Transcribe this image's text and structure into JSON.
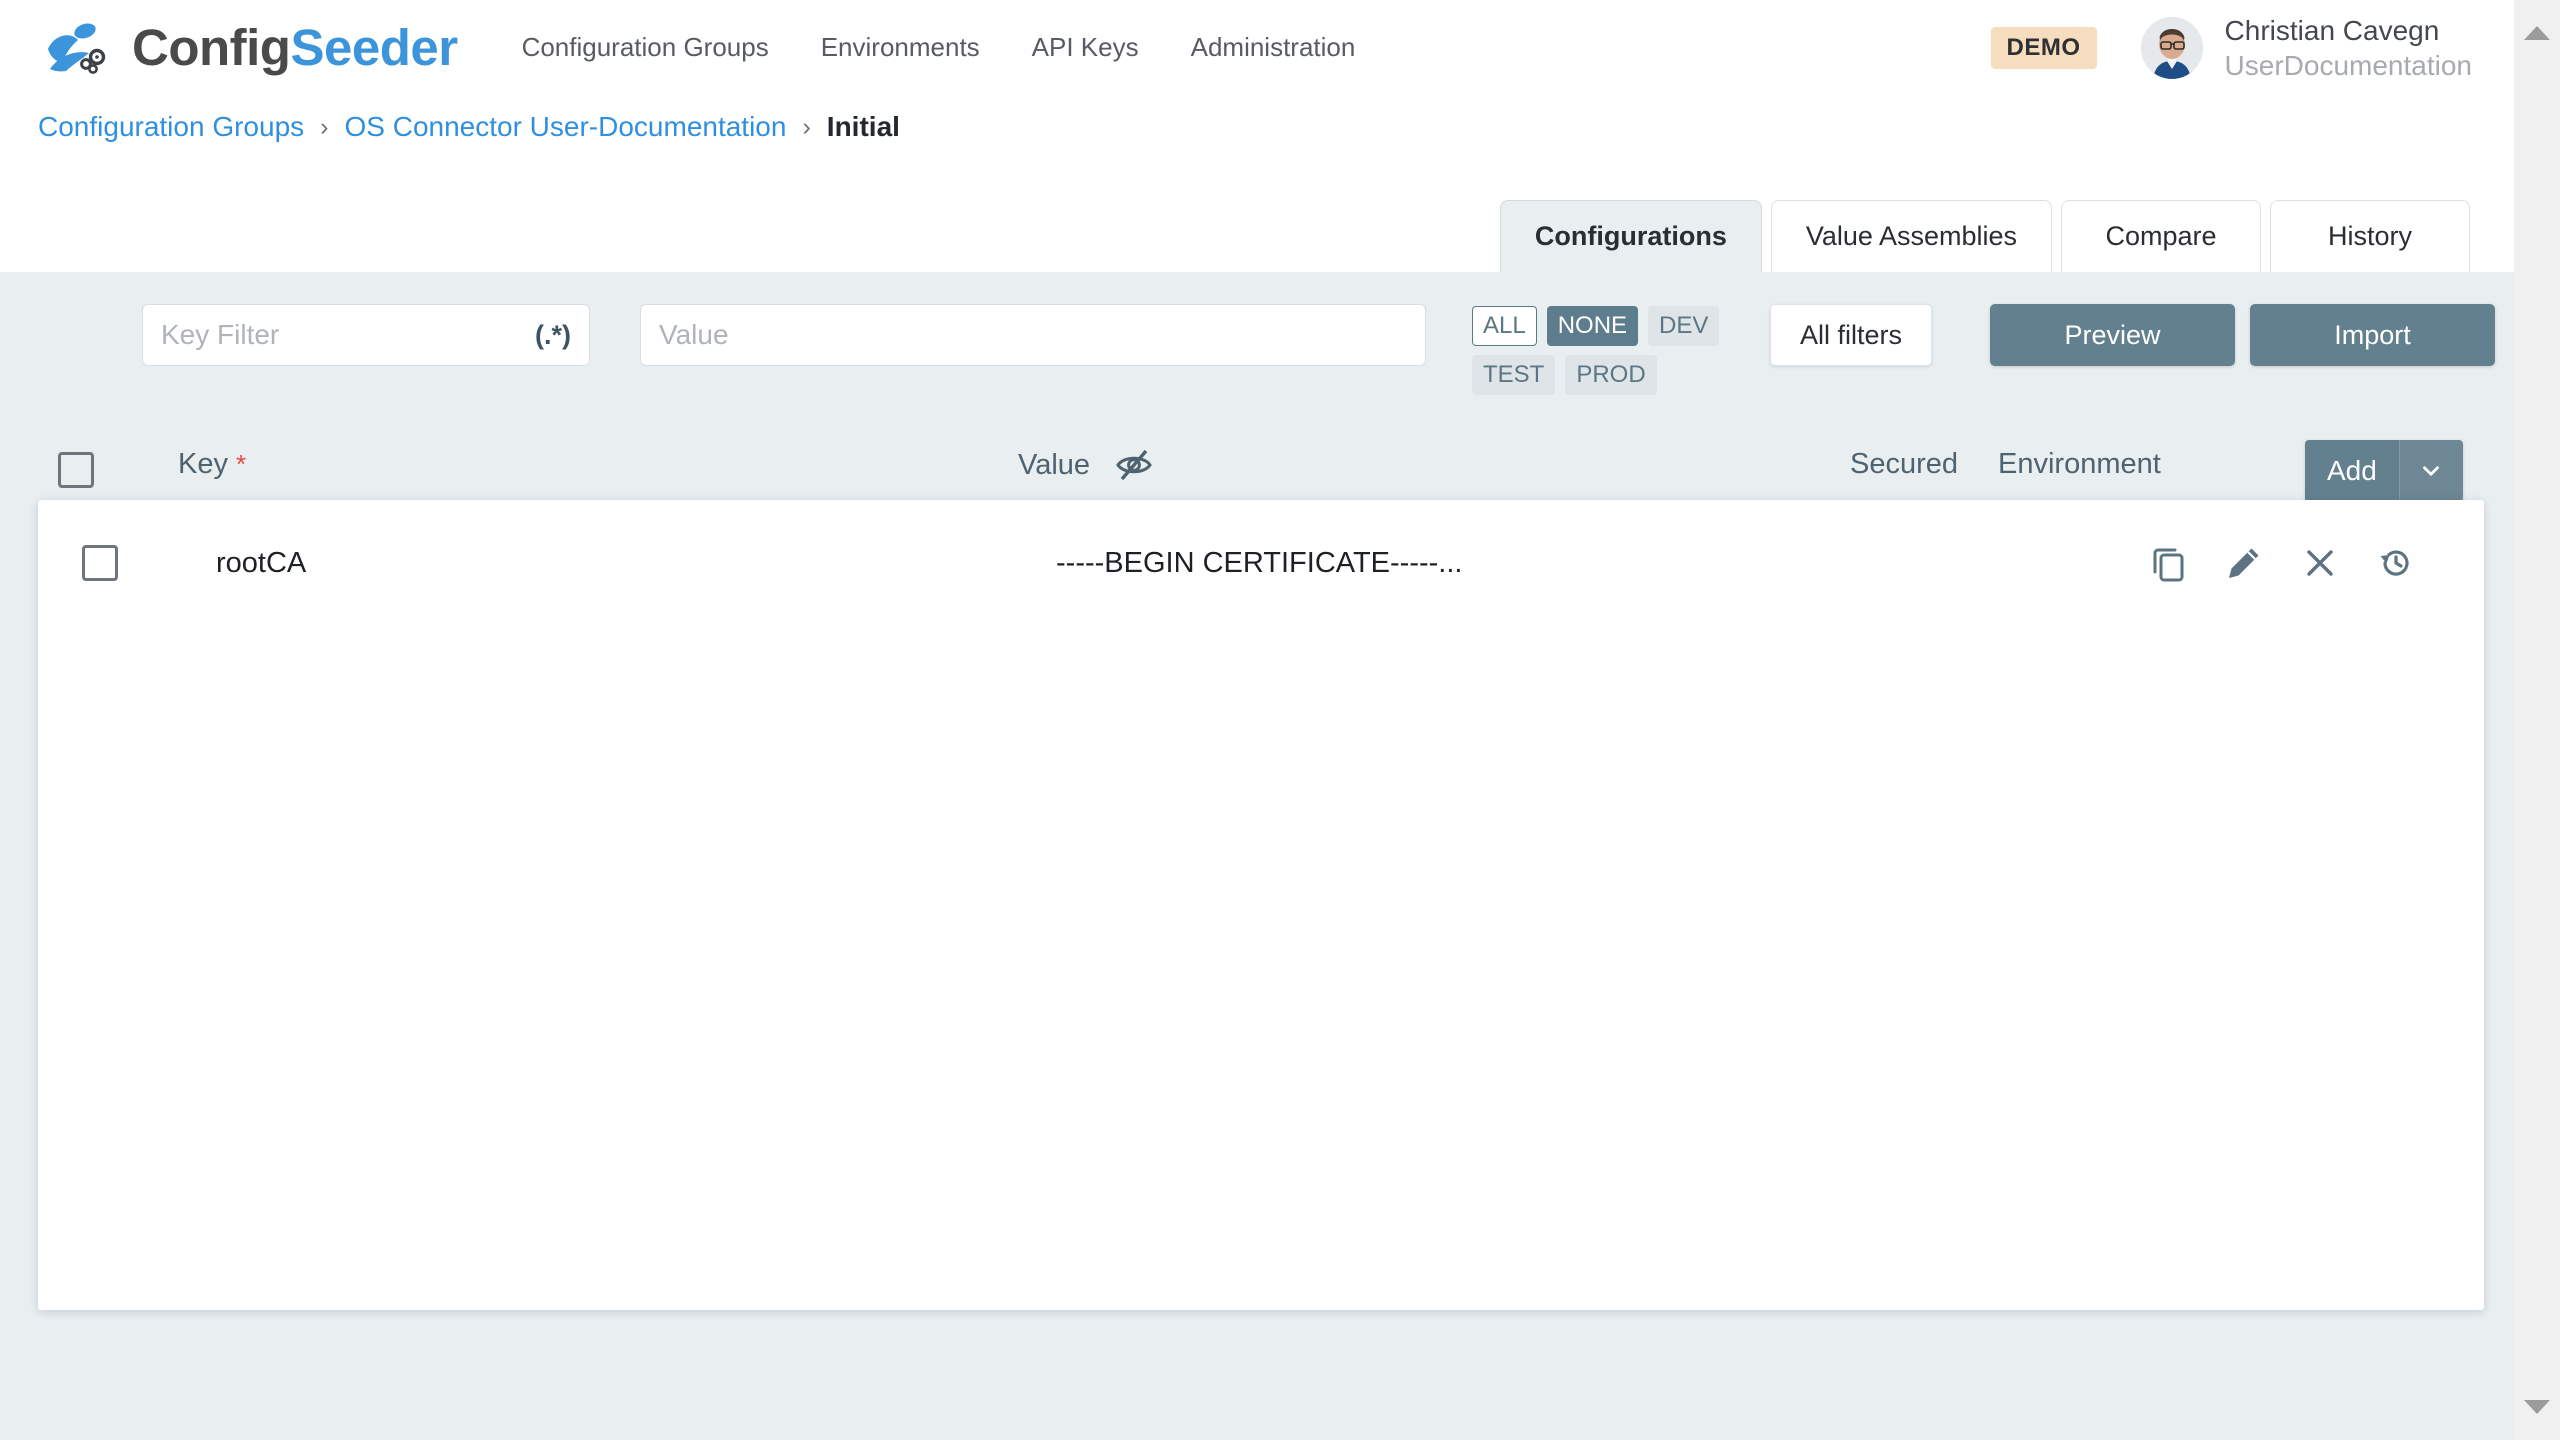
{
  "brand": {
    "name_first": "Config",
    "name_second": "Seeder",
    "logo_icon": "seeder-bird-gears-logo",
    "color_primary": "#3c94db",
    "color_dark": "#4a4a4a"
  },
  "nav": {
    "items": [
      {
        "label": "Configuration Groups"
      },
      {
        "label": "Environments"
      },
      {
        "label": "API Keys"
      },
      {
        "label": "Administration"
      }
    ]
  },
  "account": {
    "badge": "DEMO",
    "badge_bg": "#f6ddbd",
    "name": "Christian Cavegn",
    "role": "UserDocumentation",
    "avatar_icon": "user-avatar-photo"
  },
  "breadcrumb": {
    "separator": "›",
    "items": [
      {
        "label": "Configuration Groups",
        "current": false
      },
      {
        "label": "OS Connector User-Documentation",
        "current": false
      },
      {
        "label": "Initial",
        "current": true
      }
    ]
  },
  "tabs": {
    "active": "Configurations",
    "items": [
      {
        "label": "Configurations"
      },
      {
        "label": "Value Assemblies"
      },
      {
        "label": "Compare"
      },
      {
        "label": "History"
      }
    ]
  },
  "toolbar": {
    "key_filter": {
      "value": "",
      "placeholder": "Key Filter",
      "suffix": "(.*)"
    },
    "value_filter": {
      "value": "",
      "placeholder": "Value"
    },
    "env_chips": [
      {
        "label": "ALL",
        "state": "outlined"
      },
      {
        "label": "NONE",
        "state": "filled"
      },
      {
        "label": "DEV",
        "state": "plain"
      },
      {
        "label": "TEST",
        "state": "plain"
      },
      {
        "label": "PROD",
        "state": "plain"
      }
    ],
    "all_filters_label": "All filters",
    "preview_label": "Preview",
    "import_label": "Import",
    "primary_color": "#63808f"
  },
  "table": {
    "headers": {
      "key": "Key",
      "key_required_marker": "*",
      "value": "Value",
      "value_icon": "eye-slash-icon",
      "secured": "Secured",
      "environment": "Environment"
    },
    "add_button": {
      "label": "Add",
      "caret_icon": "chevron-down-icon"
    },
    "select_all_checkbox": {
      "checked": false,
      "icon": "checkbox-icon"
    },
    "rows": [
      {
        "selected": false,
        "key": "rootCA",
        "value": "-----BEGIN CERTIFICATE-----...",
        "secured": "",
        "environment": "",
        "actions": [
          {
            "icon": "copy-icon",
            "name": "copy-button"
          },
          {
            "icon": "pencil-icon",
            "name": "edit-button"
          },
          {
            "icon": "close-x-icon",
            "name": "delete-button"
          },
          {
            "icon": "history-restore-icon",
            "name": "history-button"
          }
        ]
      }
    ]
  },
  "scrollbar": {
    "up_icon": "scroll-up-arrow-icon",
    "down_icon": "scroll-down-arrow-icon"
  }
}
